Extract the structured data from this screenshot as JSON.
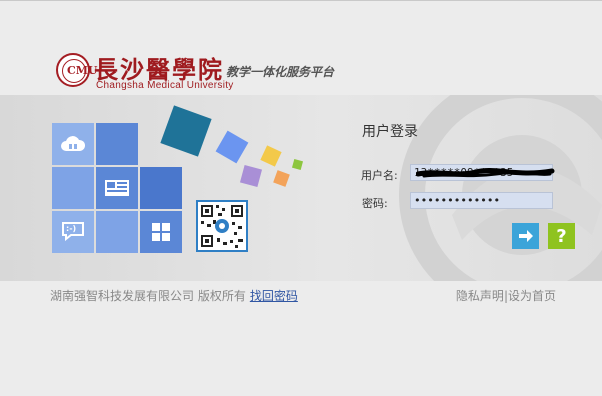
{
  "header": {
    "seal_text": "CMU",
    "school_name_cn": "長沙醫學院",
    "school_name_en": "Changsha Medical University",
    "platform_title": "教学一体化服务平台"
  },
  "tiles": {
    "cloud_label": "☁",
    "chat_label": ":-)"
  },
  "login": {
    "title": "用户登录",
    "username_label": "用户名:",
    "username_value": "13*****09****35",
    "password_label": "密码:",
    "password_value": "•••••••••••••",
    "submit_icon": "arrow-right-icon",
    "help_label": "?"
  },
  "footer": {
    "copyright": "湖南强智科技发展有限公司 版权所有",
    "forgot_password": "找回密码",
    "privacy": "隐私声明",
    "separator": "|",
    "set_home": "设为首页"
  },
  "colors": {
    "brand_red": "#9f1b1f",
    "tile_blue": "#5b87d6",
    "submit_blue": "#3ba4d9",
    "help_green": "#8fc31f"
  }
}
